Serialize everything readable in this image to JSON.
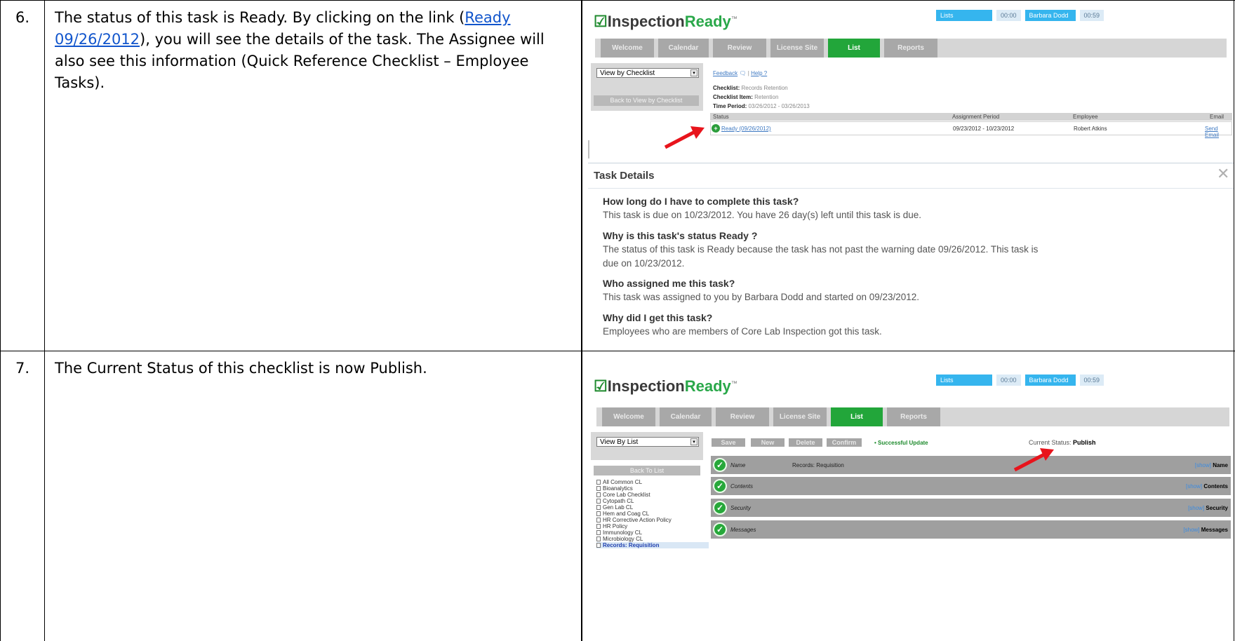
{
  "steps": [
    {
      "number": "6.",
      "text_before": "The status of this task is Ready.  By clicking on the link (",
      "link_line1": "Ready",
      "link_line2": "09/26/2012",
      "text_after": "), you will see the details of the task.  The Assignee will also see this information (Quick Reference Checklist – Employee Tasks).",
      "lines": [
        "The status of this task is Ready.  By clicking on the link (",
        "), you will see the details of the task.  The Assignee will",
        "also see this information (Quick Reference Checklist – Employee",
        "Tasks)."
      ]
    },
    {
      "number": "7.",
      "text": "The Current Status of this checklist is now Publish."
    }
  ],
  "screenshot1": {
    "logo": {
      "brand": "Inspection",
      "ready": "Ready"
    },
    "topbar": {
      "lists": "Lists",
      "time1": "00:00",
      "user": "Barbara Dodd",
      "time2": "00:59"
    },
    "tabs": [
      "Welcome",
      "Calendar",
      "Review",
      "License Site",
      "List",
      "Reports"
    ],
    "active_tab": "List",
    "view_select": "View by Checklist",
    "back_button": "Back to View by Checklist",
    "feedback": "Feedback",
    "help": "Help ?",
    "separator": "|",
    "checklist_label": "Checklist:",
    "checklist_value": "Records Retention",
    "item_label": "Checklist Item:",
    "item_value": "Retention",
    "period_label": "Time Period:",
    "period_value": "03/26/2012 - 03/26/2013",
    "columns": [
      "Status",
      "Assignment Period",
      "Employee",
      "Email"
    ],
    "row": {
      "status": "Ready (09/26/2012)",
      "period": "09/23/2012 - 10/23/2012",
      "employee": "Robert Atkins",
      "email": "Send Email"
    }
  },
  "task_details": {
    "title": "Task Details",
    "close_glyph": "✕",
    "qa": [
      {
        "q": "How long do I have to complete this task?",
        "a": [
          "This task is due on 10/23/2012. You have 26 day(s) left until this task is due."
        ]
      },
      {
        "q": "Why is this task's status  Ready ?",
        "a": [
          "The status of this task is Ready because the task has not past the warning date 09/26/2012. This task is",
          "due on 10/23/2012."
        ]
      },
      {
        "q": "Who assigned me this task?",
        "a": [
          "This task was assigned to you by Barbara Dodd and started on 09/23/2012."
        ]
      },
      {
        "q": "Why did I get this task?",
        "a": [
          "Employees who are members of  Core Lab Inspection  got this task."
        ]
      }
    ]
  },
  "screenshot2": {
    "logo": {
      "brand": "Inspection",
      "ready": "Ready"
    },
    "topbar": {
      "lists": "Lists",
      "time1": "00:00",
      "user": "Barbara Dodd",
      "time2": "00:59"
    },
    "tabs": [
      "Welcome",
      "Calendar",
      "Review",
      "License Site",
      "List",
      "Reports"
    ],
    "active_tab": "List",
    "view_select": "View By List",
    "back_button": "Back To List",
    "toolbar": [
      "Save",
      "New",
      "Delete",
      "Confirm"
    ],
    "success": "Successful Update",
    "success_bullet": "•",
    "current_status_label": "Current Status:",
    "current_status_value": "Publish",
    "sections": [
      {
        "label": "Name",
        "value": "Records: Requisition",
        "show": "[show]",
        "right": "Name"
      },
      {
        "label": "Contents",
        "value": "",
        "show": "[show]",
        "right": "Contents"
      },
      {
        "label": "Security",
        "value": "",
        "show": "[show]",
        "right": "Security"
      },
      {
        "label": "Messages",
        "value": "",
        "show": "[show]",
        "right": "Messages"
      }
    ],
    "tree": [
      "All Common CL",
      "Bioanalytics",
      "Core Lab Checklist",
      "Cytopath CL",
      "Gen Lab CL",
      "Hem and Coag CL",
      "HR Corrective Action Policy",
      "HR Policy",
      "Immunology CL",
      "Microbiology CL",
      "Records: Requisition"
    ],
    "tree_selected": "Records: Requisition"
  },
  "icons": {
    "arrow": "red-arrow-icon",
    "check": "check-circle-icon",
    "close": "close-icon",
    "feedback": "speech-bubble-icon"
  }
}
